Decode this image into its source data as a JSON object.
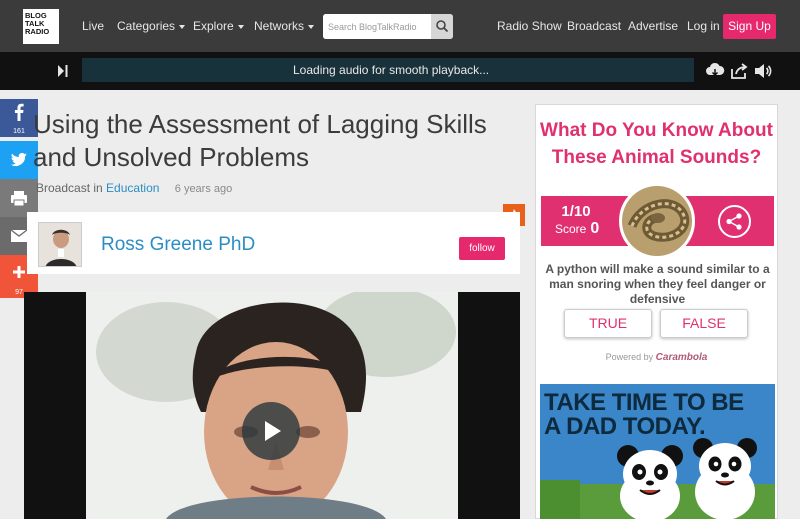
{
  "logo": {
    "lines": [
      "BLOG",
      "TALK",
      "RADIO"
    ]
  },
  "nav": {
    "live": "Live",
    "categories": "Categories",
    "explore": "Explore",
    "networks": "Networks",
    "radio_show": "Radio Show",
    "broadcast": "Broadcast",
    "advertise": "Advertise",
    "login": "Log in",
    "signup": "Sign Up"
  },
  "search": {
    "placeholder": "Search BlogTalkRadio"
  },
  "player": {
    "status": "Loading audio for smooth playback..."
  },
  "social": {
    "facebook_count": "161",
    "share_count": "97"
  },
  "episode": {
    "title": "Using the Assessment of Lagging Skills and Unsolved Problems",
    "meta_prefix": "Broadcast in",
    "category": "Education",
    "age": "6 years ago"
  },
  "host": {
    "name": "Ross Greene PhD",
    "follow": "follow"
  },
  "quiz": {
    "title": "What Do You Know About These Animal Sounds?",
    "progress": "1/10",
    "score_label": "Score",
    "score_value": "0",
    "question": "A python will make a sound similar to a man snoring when they feel danger or defensive",
    "true_label": "TRUE",
    "false_label": "FALSE",
    "powered_prefix": "Powered by",
    "powered_brand": "Carambola"
  },
  "ad": {
    "headline_1": "TAKE TIME TO BE",
    "headline_2": "A DAD TODAY."
  },
  "colors": {
    "brand_pink": "#e6296c",
    "link_blue": "#2a8ec4",
    "nav_bg": "#3b3b3b",
    "facebook": "#3b5998",
    "twitter": "#1da1f2"
  }
}
